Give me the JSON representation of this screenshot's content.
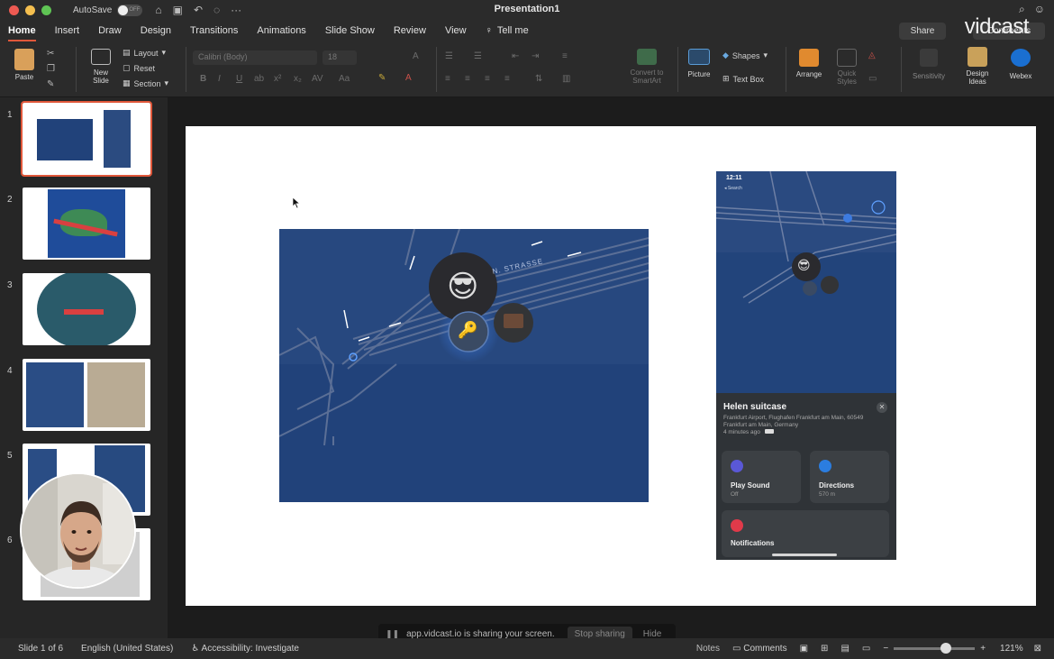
{
  "titlebar": {
    "autosave_label": "AutoSave",
    "autosave_state": "OFF",
    "doc_title": "Presentation1"
  },
  "tabs": [
    "Home",
    "Insert",
    "Draw",
    "Design",
    "Transitions",
    "Animations",
    "Slide Show",
    "Review",
    "View"
  ],
  "tell_me": "Tell me",
  "share_label": "Share",
  "comments_label": "Comments",
  "watermark": "vidcast",
  "ribbon": {
    "paste": "Paste",
    "new_slide": "New\nSlide",
    "layout": "Layout",
    "reset": "Reset",
    "section": "Section",
    "font_name": "Calibri (Body)",
    "font_size": "18",
    "convert_smartart": "Convert to\nSmartArt",
    "picture": "Picture",
    "shapes": "Shapes",
    "text_box": "Text Box",
    "arrange": "Arrange",
    "quick_styles": "Quick\nStyles",
    "sensitivity": "Sensitivity",
    "design_ideas": "Design\nIdeas",
    "webex": "Webex"
  },
  "slides": [
    {
      "number": "1",
      "selected": true
    },
    {
      "number": "2",
      "selected": false
    },
    {
      "number": "3",
      "selected": false
    },
    {
      "number": "4",
      "selected": false
    },
    {
      "number": "5",
      "selected": false
    },
    {
      "number": "6",
      "selected": false
    }
  ],
  "slide_content": {
    "street_label": "N. STRASSE",
    "phone": {
      "time": "12:11",
      "back_label": "◂ Search",
      "title": "Helen suitcase",
      "address": "Frankfurt Airport, Flughafen Frankfurt am Main, 60549 Frankfurt am Main, Germany",
      "time_ago": "4 minutes ago",
      "play_sound": "Play Sound",
      "play_sound_sub": "Off",
      "directions": "Directions",
      "directions_sub": "570 m",
      "notifications": "Notifications"
    }
  },
  "share_bar": {
    "message": "app.vidcast.io is sharing your screen.",
    "stop": "Stop sharing",
    "hide": "Hide"
  },
  "status": {
    "slide_of": "Slide 1 of 6",
    "language": "English (United States)",
    "accessibility": "Accessibility: Investigate",
    "notes": "Notes",
    "comments": "Comments",
    "zoom": "121%"
  },
  "colors": {
    "accent": "#e0573a",
    "map_blue": "#21427a"
  }
}
